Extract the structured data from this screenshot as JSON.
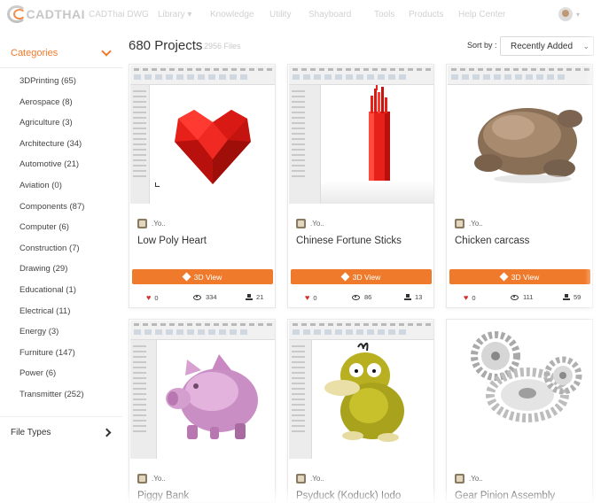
{
  "nav": {
    "logo_text": "CADTHAI",
    "items": [
      "CADThai DWG",
      "Library ▾",
      "Knowledge",
      "Utility",
      "Shayboard",
      "Tools",
      "Products",
      "Help Center"
    ],
    "avatar_icon": "user-avatar",
    "caret": "▾"
  },
  "sidebar": {
    "categories_title": "Categories",
    "categories": [
      "3DPrinting (65)",
      "Aerospace (8)",
      "Agriculture (3)",
      "Architecture (34)",
      "Automotive (21)",
      "Aviation (0)",
      "Components (87)",
      "Computer (6)",
      "Construction (7)",
      "Drawing (29)",
      "Educational (1)",
      "Electrical (11)",
      "Energy (3)",
      "Furniture (147)",
      "Power (6)",
      "Transmitter (252)"
    ],
    "file_types_label": "File Types"
  },
  "main": {
    "project_count": "680 Projects",
    "file_count": "2956 Files",
    "sort_label": "Sort by :",
    "sort_value": "Recently Added",
    "sort_caret": "⌄"
  },
  "cards": [
    {
      "user": ".Yo..",
      "title": "Low Poly Heart",
      "button": "3D View",
      "likes": "0",
      "views": "334",
      "downloads": "21"
    },
    {
      "user": ".Yo..",
      "title": "Chinese Fortune Sticks",
      "button": "3D View",
      "likes": "0",
      "views": "86",
      "downloads": "13"
    },
    {
      "user": ".Yo..",
      "title": "Chicken carcass",
      "button": "3D View",
      "likes": "0",
      "views": "111",
      "downloads": "59"
    },
    {
      "user": ".Yo..",
      "title": "Piggy Bank"
    },
    {
      "user": ".Yo..",
      "title": "Psyduck (Koduck) Iodo"
    },
    {
      "user": ".Yo..",
      "title": "Gear Pinion Assembly"
    }
  ],
  "colors": {
    "accent": "#f07a2b",
    "heart": "#d32f2f"
  }
}
